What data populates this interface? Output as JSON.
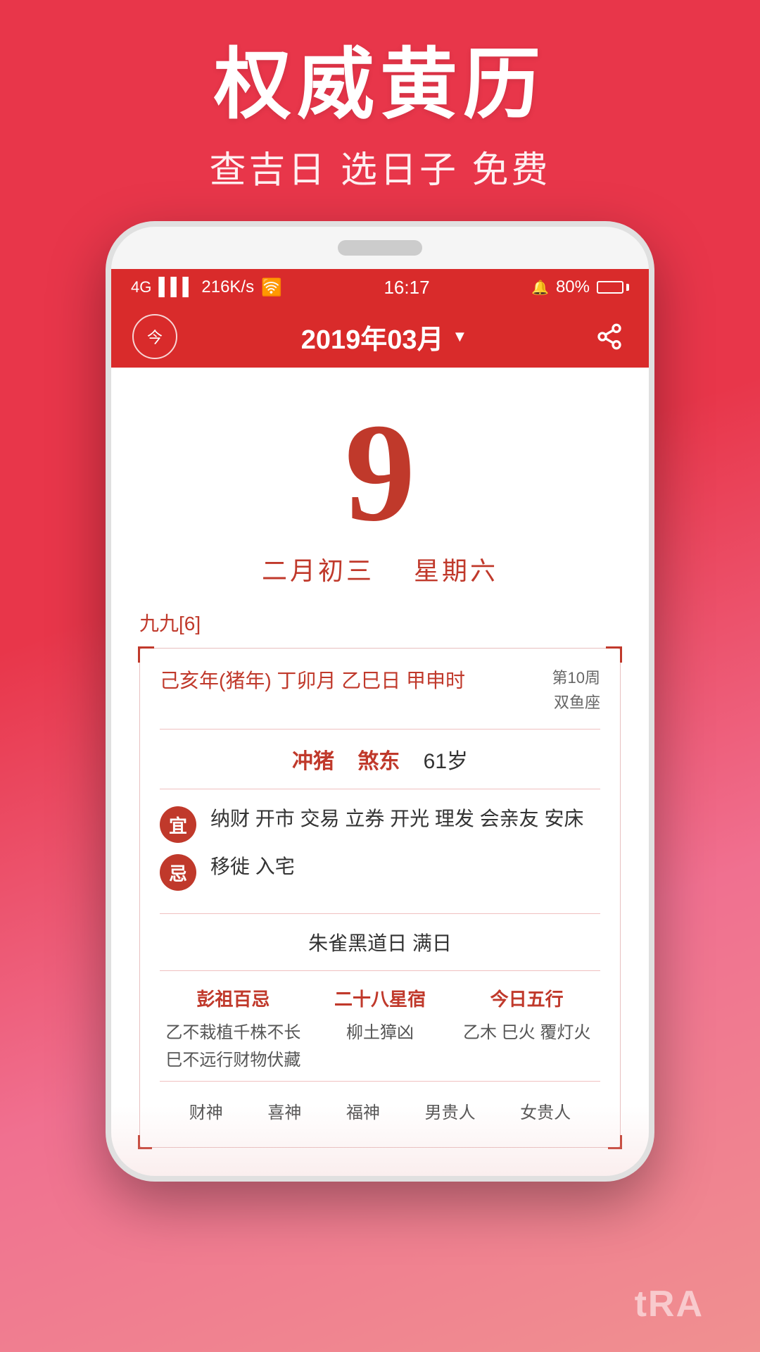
{
  "background": {
    "gradient_start": "#e8364a",
    "gradient_end": "#f09090"
  },
  "hero": {
    "main_title": "权威黄历",
    "sub_title": "查吉日 选日子 免费"
  },
  "phone": {
    "status_bar": {
      "signal": "4G",
      "network_speed": "216K/s",
      "wifi": "WiFi",
      "time": "16:17",
      "alarm": "🔔",
      "battery_percent": "80%"
    },
    "app_header": {
      "today_btn_label": "今",
      "month_label": "2019年03月",
      "dropdown_arrow": "▼"
    },
    "date_display": {
      "day_number": "9",
      "lunar_date": "二月初三",
      "weekday": "星期六"
    },
    "calendar_info": {
      "jiu_jiu": "九九[6]",
      "ganzhi": {
        "main": "己亥年(猪年) 丁卯月 乙巳日 甲申时",
        "side_line1": "第10周",
        "side_line2": "双鱼座"
      },
      "chong": {
        "label": "冲猪",
        "direction": "煞东",
        "age": "61岁"
      },
      "yi": {
        "badge": "宜",
        "content": "纳财 开市 交易 立券 开光 理发 会亲友 安床"
      },
      "ji": {
        "badge": "忌",
        "content": "移徙 入宅"
      },
      "black_day": "朱雀黑道日  满日",
      "three_cols": {
        "col1": {
          "title": "彭祖百忌",
          "content_line1": "乙不栽植千株不长",
          "content_line2": "巳不远行财物伏藏"
        },
        "col2": {
          "title": "二十八星宿",
          "content": "柳土獐凶"
        },
        "col3": {
          "title": "今日五行",
          "content": "乙木 巳火 覆灯火"
        }
      },
      "bottom_labels": [
        "财神",
        "喜神",
        "福神",
        "男贵人",
        "女贵人"
      ]
    }
  },
  "brand": {
    "text": "tRA"
  }
}
